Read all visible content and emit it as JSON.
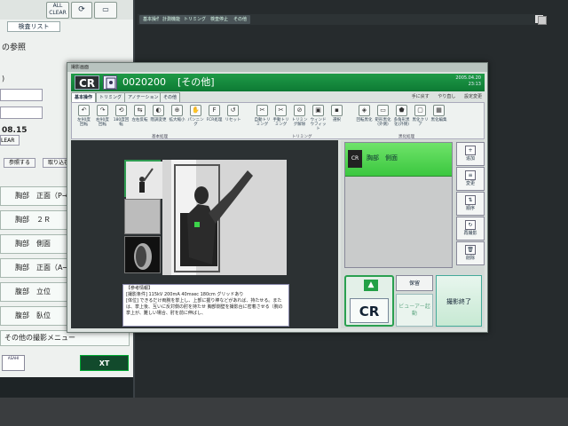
{
  "left_app": {
    "buttons": [
      "ALL CLEAR"
    ],
    "tab": "検査リスト",
    "fragments": {
      "ref": "の参照",
      "paren": ")",
      "date": "08.15",
      "clear": "LEAR",
      "ref_btn": "参照する",
      "import_btn": "取り込む"
    },
    "items": [
      "胸部　正面（P→A）",
      "胸部　２Ｒ",
      "胸部　側面",
      "胸部　正面（A→P）",
      "腹部　立位",
      "腹部　臥位",
      "その他の撮影メニュー"
    ],
    "logo": "ASAHI",
    "xt_button": "XT"
  },
  "top_strip": {
    "tabs": [
      "基本操作",
      "計測機能",
      "トリミング",
      "検査停止",
      "その他"
    ]
  },
  "dialog": {
    "title": "撮影画面",
    "logo": "CR",
    "patient_id": "0020200",
    "category": "[その他]",
    "date": "2005.04.20",
    "time": "23:13",
    "tabs": [
      "基本操作",
      "トリミング",
      "アノテーション",
      "その他"
    ],
    "top_right": [
      "手に戻す",
      "やり直し",
      "設定変更"
    ],
    "tools": [
      {
        "label": "左90度回転",
        "icon": "rotate-left-icon"
      },
      {
        "label": "右90度回転",
        "icon": "rotate-right-icon"
      },
      {
        "label": "180度回転",
        "icon": "rotate-180-icon"
      },
      {
        "label": "左右反転",
        "icon": "flip-h-icon"
      },
      {
        "label": "階調変更",
        "icon": "gradation-icon"
      },
      {
        "label": "拡大縮小",
        "icon": "zoom-icon"
      },
      {
        "label": "パンニング",
        "icon": "hand-icon"
      },
      {
        "label": "FCR処理",
        "icon": "fcr-icon"
      },
      {
        "label": "リセット",
        "icon": "reset-icon"
      },
      {
        "label": "自動トリミング",
        "icon": "auto-trim-icon"
      },
      {
        "label": "手動トリミング",
        "icon": "manual-trim-icon"
      },
      {
        "label": "トリミング解除",
        "icon": "trim-clear-icon"
      },
      {
        "label": "ウィンドウフィット",
        "icon": "window-fit-icon"
      },
      {
        "label": "選択",
        "icon": "select-icon"
      },
      {
        "label": "回転黒化",
        "icon": "rot-black-icon"
      },
      {
        "label": "矩形黒化(外側)",
        "icon": "rect-black-icon"
      },
      {
        "label": "多角形黒化(外側)",
        "icon": "poly-black-icon"
      },
      {
        "label": "黒化クリア",
        "icon": "black-clear-icon"
      },
      {
        "label": "黒化編集",
        "icon": "black-edit-icon"
      }
    ],
    "groups": [
      "基本処理",
      "トリミング",
      "黒化処理"
    ],
    "info_text": "【参考情報】\n[撮影条件] 115kV 200mA 40msec 180cm グリッドあり\n[体位] できるだけ両腕を挙上し、上部に握り棒などがあれば、持たせる。または、挙上後、互いに反対側の肘を持たせ 胸部側壁を撮影台に密着させる（腕の挙上が、難しい場合、肘を前に伸ばし、",
    "protocol": {
      "label": "胸部　側面",
      "icon_text": "CR"
    },
    "side_buttons": [
      {
        "label": "追加",
        "icon": "add-icon"
      },
      {
        "label": "変更",
        "icon": "edit-icon"
      },
      {
        "label": "順序",
        "icon": "order-icon"
      },
      {
        "label": "再撮影",
        "icon": "reshoot-icon"
      },
      {
        "label": "削除",
        "icon": "delete-icon"
      }
    ],
    "cr_button": "CR",
    "hold_button": "保留",
    "viewer_button": "ビューアー起動",
    "end_button": "撮影終了"
  }
}
